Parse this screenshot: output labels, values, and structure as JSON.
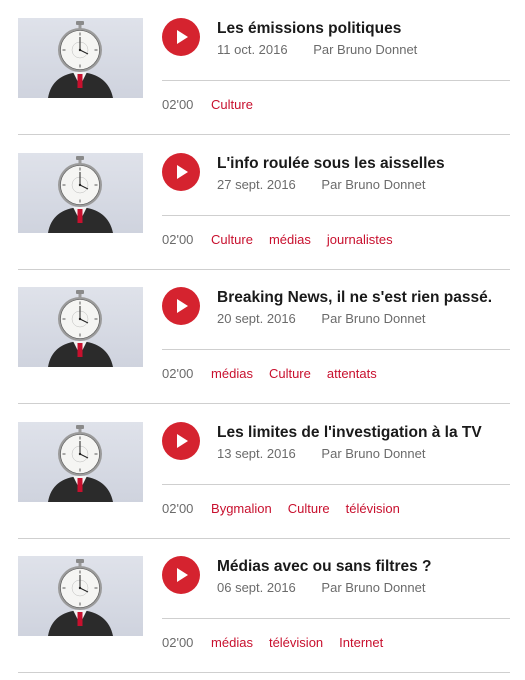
{
  "episodes": [
    {
      "title": "Les émissions politiques",
      "date": "11 oct. 2016",
      "author": "Par Bruno Donnet",
      "duration": "02'00",
      "tags": [
        "Culture"
      ]
    },
    {
      "title": "L'info roulée sous les aisselles",
      "date": "27 sept. 2016",
      "author": "Par Bruno Donnet",
      "duration": "02'00",
      "tags": [
        "Culture",
        "médias",
        "journalistes"
      ]
    },
    {
      "title": "Breaking News, il ne s'est rien passé.",
      "date": "20 sept. 2016",
      "author": "Par Bruno Donnet",
      "duration": "02'00",
      "tags": [
        "médias",
        "Culture",
        "attentats"
      ]
    },
    {
      "title": "Les limites de l'investigation à la TV",
      "date": "13 sept. 2016",
      "author": "Par Bruno Donnet",
      "duration": "02'00",
      "tags": [
        "Bygmalion",
        "Culture",
        "télévision"
      ]
    },
    {
      "title": "Médias avec ou sans filtres ?",
      "date": "06 sept. 2016",
      "author": "Par Bruno Donnet",
      "duration": "02'00",
      "tags": [
        "médias",
        "télévision",
        "Internet"
      ]
    }
  ],
  "thumbnail_icon": "stopwatch-head-man-icon",
  "colors": {
    "accent": "#d5232f",
    "tag": "#c8102e",
    "meta": "#6b6b6b",
    "rule": "#cfcfcf"
  }
}
